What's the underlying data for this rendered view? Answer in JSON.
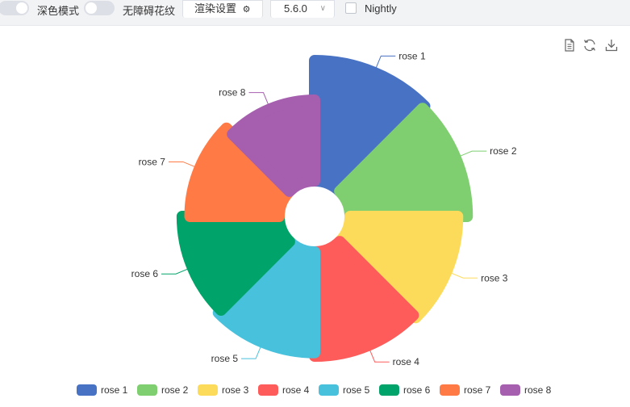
{
  "toolbar": {
    "dark_mode_label": "深色模式",
    "decal_label": "无障碍花纹",
    "render_settings_label": "渲染设置",
    "version_value": "5.6.0",
    "nightly_label": "Nightly"
  },
  "chart_data": {
    "type": "pie",
    "rose_type": "area",
    "start_angle_deg": 90,
    "categories": [
      "rose 1",
      "rose 2",
      "rose 3",
      "rose 4",
      "rose 5",
      "rose 6",
      "rose 7",
      "rose 8"
    ],
    "values": [
      40,
      38,
      32,
      30,
      28,
      26,
      22,
      18
    ],
    "colors": [
      "#4872c4",
      "#7fcf71",
      "#fddb5a",
      "#fd5c5a",
      "#48c1dd",
      "#00a369",
      "#ff7a45",
      "#a55fae"
    ],
    "legend": {
      "position": "bottom",
      "items": [
        "rose 1",
        "rose 2",
        "rose 3",
        "rose 4",
        "rose 5",
        "rose 6",
        "rose 7",
        "rose 8"
      ]
    },
    "grid": false
  }
}
